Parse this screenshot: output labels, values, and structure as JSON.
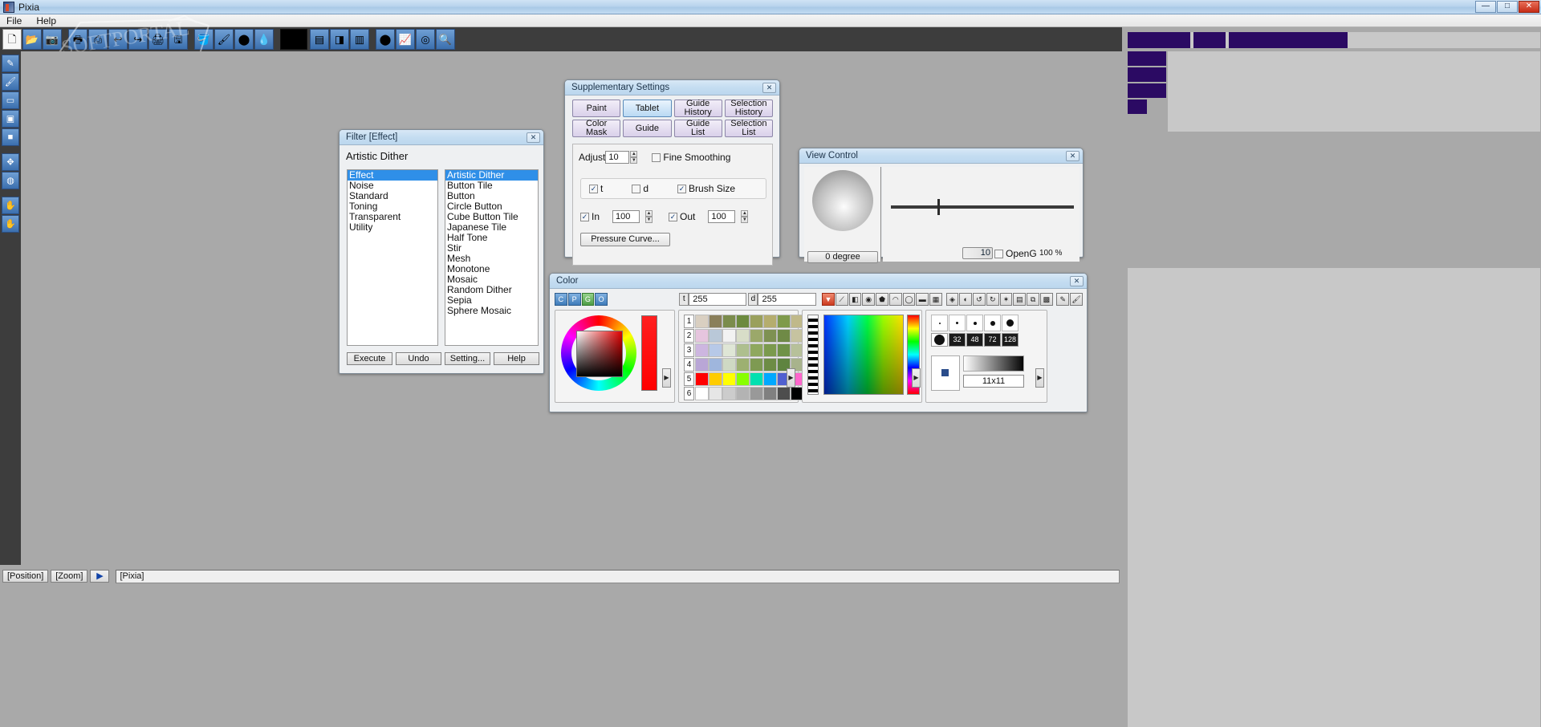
{
  "window": {
    "app_title": "Pixia",
    "app_icon": "pixia-app-icon",
    "buttons": {
      "minimize": "—",
      "maximize": "□",
      "close": "✕"
    }
  },
  "menubar": {
    "items": [
      "File",
      "Help"
    ]
  },
  "toolbar": {
    "groups": [
      {
        "name": "file",
        "buttons": [
          {
            "icon": "new-document-icon",
            "glyph": "🗋"
          },
          {
            "icon": "open-folder-icon",
            "glyph": "📂"
          },
          {
            "icon": "camera-import-icon",
            "glyph": "📷"
          }
        ]
      },
      {
        "name": "edit",
        "buttons": [
          {
            "icon": "print-icon",
            "glyph": "🖶"
          },
          {
            "icon": "scan-icon",
            "glyph": "⎙"
          },
          {
            "icon": "undo-icon",
            "glyph": "↩"
          },
          {
            "icon": "redo-icon",
            "glyph": "↪"
          },
          {
            "icon": "print-preview-icon",
            "glyph": "🖨"
          },
          {
            "icon": "save-icon",
            "glyph": "🖫"
          }
        ]
      },
      {
        "name": "paint",
        "buttons": [
          {
            "icon": "paint-bucket-icon",
            "glyph": "🪣"
          },
          {
            "icon": "paint-roller-icon",
            "glyph": "🖌"
          },
          {
            "icon": "sphere-gradient-icon",
            "glyph": "⬤"
          },
          {
            "icon": "eyedropper-icon",
            "glyph": "💧"
          }
        ]
      },
      {
        "name": "color-swatch",
        "buttons": [
          {
            "icon": "foreground-color-swatch",
            "glyph": ""
          }
        ]
      },
      {
        "name": "effects",
        "buttons": [
          {
            "icon": "image-effect-icon",
            "glyph": "▤"
          },
          {
            "icon": "filter-icon",
            "glyph": "◨"
          },
          {
            "icon": "layer-icon",
            "glyph": "▥"
          }
        ]
      },
      {
        "name": "view",
        "buttons": [
          {
            "icon": "record-icon",
            "glyph": "⬤"
          },
          {
            "icon": "chart-icon",
            "glyph": "📈"
          },
          {
            "icon": "view-control-icon",
            "glyph": "◎"
          },
          {
            "icon": "zoom-icon",
            "glyph": "🔍"
          }
        ]
      }
    ]
  },
  "left_rail": {
    "buttons": [
      {
        "icon": "pencil-tool-icon",
        "glyph": "✎"
      },
      {
        "icon": "brush-tool-icon",
        "glyph": "🖌"
      },
      {
        "icon": "rect-select-tool-icon",
        "glyph": "▭"
      },
      {
        "icon": "fill-rect-tool-icon",
        "glyph": "▣"
      },
      {
        "icon": "square-tool-icon",
        "glyph": "■"
      },
      {
        "icon": "transform-tool-icon",
        "glyph": "✥"
      },
      {
        "icon": "palette-tool-icon",
        "glyph": "◍"
      },
      {
        "icon": "hand-tool-icon",
        "glyph": "✋"
      },
      {
        "icon": "stamp-tool-icon",
        "glyph": "✋"
      }
    ]
  },
  "filter_dialog": {
    "title": "Filter [Effect]",
    "close_label": "✕",
    "subtitle": "Artistic Dither",
    "categories": [
      "Effect",
      "Noise",
      "Standard",
      "Toning",
      "Transparent",
      "Utility"
    ],
    "selected_category": "Effect",
    "effects": [
      "Artistic Dither",
      "Button Tile",
      "Button",
      "Circle Button",
      "Cube Button Tile",
      "Japanese Tile",
      "Half Tone",
      "Stir",
      "Mesh",
      "Monotone",
      "Mosaic",
      "Random Dither",
      "Sepia",
      "Sphere Mosaic"
    ],
    "selected_effect": "Artistic Dither",
    "buttons": [
      "Execute",
      "Undo",
      "Setting...",
      "Help"
    ]
  },
  "supplementary_settings": {
    "title": "Supplementary Settings",
    "close_label": "✕",
    "tabs_row1": [
      {
        "label": "Paint",
        "active": false
      },
      {
        "label": "Tablet",
        "active": true
      },
      {
        "label": "Guide\nHistory",
        "active": false
      },
      {
        "label": "Selection\nHistory",
        "active": false
      }
    ],
    "tabs_row2": [
      {
        "label": "Color\nMask",
        "active": false
      },
      {
        "label": "Guide",
        "active": false
      },
      {
        "label": "Guide\nList",
        "active": false
      },
      {
        "label": "Selection\nList",
        "active": false
      }
    ],
    "adjust_label": "Adjust",
    "adjust_value": "10",
    "fine_smoothing": {
      "label": "Fine Smoothing",
      "checked": false
    },
    "toggles": [
      {
        "label": "t",
        "checked": true
      },
      {
        "label": "d",
        "checked": false
      },
      {
        "label": "Brush Size",
        "checked": true
      }
    ],
    "in": {
      "label": "In",
      "checked": true,
      "value": "100"
    },
    "out": {
      "label": "Out",
      "checked": true,
      "value": "100"
    },
    "pressure_curve_button": "Pressure Curve..."
  },
  "view_control": {
    "title": "View Control",
    "close_label": "✕",
    "rotation_button": "0 degree",
    "zoom_value": "10",
    "opengl": {
      "label": "OpenG",
      "checked": false
    },
    "zoom_percent": "100 %"
  },
  "color_panel": {
    "title": "Color",
    "close_label": "✕",
    "mode_buttons": [
      "C",
      "P",
      "G",
      "O"
    ],
    "t_tag": "t",
    "t_value": "255",
    "d_tag": "d",
    "d_value": "255",
    "tool_icons": [
      "dropper-icon",
      "slash-icon",
      "square-icon",
      "circle-icon",
      "hexagon-icon",
      "arc-icon",
      "disc-icon",
      "bar-icon",
      "blocks-icon",
      "diamond-icon",
      "half-circle-icon",
      "rotate-left-icon",
      "rotate-right-icon",
      "star-icon",
      "window-icon",
      "copy-icon",
      "grid-icon",
      "pen-icon",
      "brush-icon"
    ],
    "palette_rows": [
      "1",
      "2",
      "3",
      "4",
      "5",
      "6"
    ],
    "palette_colors": [
      [
        "#d9cfc1",
        "#8a7f5a",
        "#7b8c4c",
        "#6c8a3e",
        "#9aa05c",
        "#b5ad6e",
        "#7f9a4b",
        "#c0b98a"
      ],
      [
        "#e6c5de",
        "#b9c8d8",
        "#f2f2f2",
        "#d8ddc8",
        "#9ba86a",
        "#7e9152",
        "#6f8a46",
        "#c6c3a0"
      ],
      [
        "#cdb6e0",
        "#b7c9e8",
        "#dfe6d6",
        "#aebf8e",
        "#8fa85e",
        "#7b9a4d",
        "#6f9247",
        "#b7c19a"
      ],
      [
        "#b9a6d6",
        "#9fb6dd",
        "#cfd9c4",
        "#9db071",
        "#7e9a52",
        "#6d8c45",
        "#5f8440",
        "#a8b38c"
      ],
      [
        "#ff0000",
        "#ffcc00",
        "#ffff00",
        "#88ff00",
        "#00e0b0",
        "#00a8ff",
        "#5060d0",
        "#ff66cc"
      ],
      [
        "#ffffff",
        "#e6e6e6",
        "#cccccc",
        "#b3b3b3",
        "#999999",
        "#808080",
        "#4d4d4d",
        "#000000"
      ]
    ],
    "brush_sizes": [
      "32",
      "48",
      "72",
      "128"
    ],
    "brush_size_label": "11x11"
  },
  "status_bar": {
    "position_button": "[Position]",
    "zoom_button": "[Zoom]",
    "play_button": "▶",
    "field_value": "[Pixia]"
  },
  "colors": {
    "desktop": "#a9a9a9",
    "toolbar": "#3d3d3d",
    "accent_blue": "#2f8fe8",
    "title_gradient_top": "#d8e8f6",
    "layer_purple": "#2b0a63"
  }
}
